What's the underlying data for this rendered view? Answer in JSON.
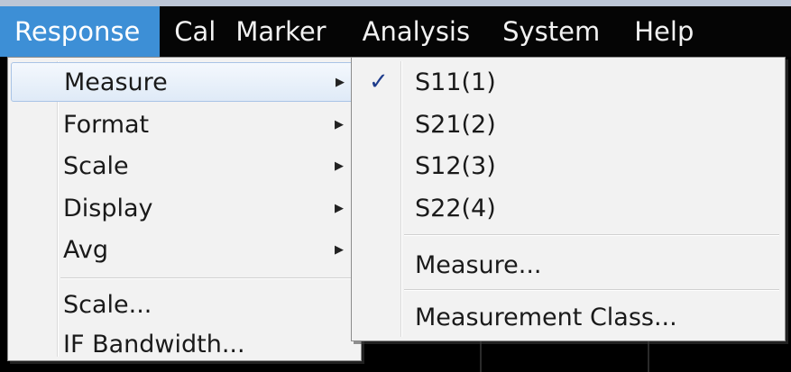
{
  "menubar": {
    "items": [
      "Response",
      "Cal",
      "Marker",
      "Analysis",
      "System",
      "Help"
    ]
  },
  "response_menu": {
    "items": [
      {
        "label": "Measure",
        "has_submenu": true,
        "highlighted": true
      },
      {
        "label": "Format",
        "has_submenu": true
      },
      {
        "label": "Scale",
        "has_submenu": true
      },
      {
        "label": "Display",
        "has_submenu": true
      },
      {
        "label": "Avg",
        "has_submenu": true
      },
      {
        "label": "Scale..."
      },
      {
        "label": "IF Bandwidth..."
      }
    ],
    "arrow_glyph": "▶"
  },
  "measure_submenu": {
    "check_glyph": "✓",
    "items": [
      {
        "label": "S11(1)",
        "checked": true
      },
      {
        "label": "S21(2)"
      },
      {
        "label": "S12(3)"
      },
      {
        "label": "S22(4)"
      },
      {
        "label": "Measure..."
      },
      {
        "label": "Measurement Class..."
      }
    ]
  },
  "colors": {
    "menubar_bg": "#050505",
    "active_menu_bg": "#3d8fd6",
    "menu_bg": "#f2f2f2",
    "check_color": "#1e3c8c"
  }
}
